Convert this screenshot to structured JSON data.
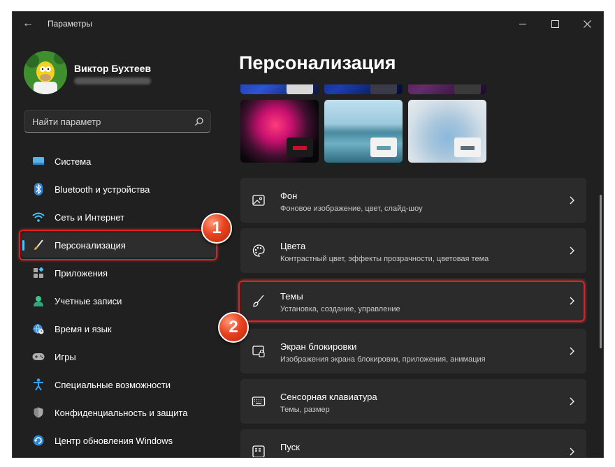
{
  "window": {
    "title": "Параметры",
    "back_icon": "back-arrow-icon",
    "controls": [
      "minimize-icon",
      "maximize-icon",
      "close-icon"
    ]
  },
  "user": {
    "name": "Виктор Бухтеев",
    "avatar_icon": "avatar-image-icon"
  },
  "search": {
    "placeholder": "Найти параметр",
    "icon": "search-icon"
  },
  "sidebar": {
    "items": [
      {
        "label": "Система",
        "icon": "system-icon"
      },
      {
        "label": "Bluetooth и устройства",
        "icon": "bluetooth-icon"
      },
      {
        "label": "Сеть и Интернет",
        "icon": "wifi-icon"
      },
      {
        "label": "Персонализация",
        "icon": "brush-icon",
        "selected": true
      },
      {
        "label": "Приложения",
        "icon": "apps-icon"
      },
      {
        "label": "Учетные записи",
        "icon": "person-icon"
      },
      {
        "label": "Время и язык",
        "icon": "globe-clock-icon"
      },
      {
        "label": "Игры",
        "icon": "gamepad-icon"
      },
      {
        "label": "Специальные возможности",
        "icon": "accessibility-icon"
      },
      {
        "label": "Конфиденциальность и защита",
        "icon": "shield-icon"
      },
      {
        "label": "Центр обновления Windows",
        "icon": "update-icon"
      }
    ]
  },
  "main": {
    "title": "Персонализация",
    "themes": [
      {
        "name": "glow",
        "accent": "#c8102e"
      },
      {
        "name": "captured-motion",
        "accent": "#5f9ea8"
      },
      {
        "name": "flow",
        "accent": "#5f6f7a"
      }
    ],
    "settings": [
      {
        "title": "Фон",
        "description": "Фоновое изображение, цвет, слайд-шоу",
        "icon": "picture-icon"
      },
      {
        "title": "Цвета",
        "description": "Контрастный цвет, эффекты прозрачности, цветовая тема",
        "icon": "palette-icon"
      },
      {
        "title": "Темы",
        "description": "Установка, создание, управление",
        "icon": "brush-icon"
      },
      {
        "title": "Экран блокировки",
        "description": "Изображения экрана блокировки, приложения, анимация",
        "icon": "lock-screen-icon"
      },
      {
        "title": "Сенсорная клавиатура",
        "description": "Темы, размер",
        "icon": "keyboard-icon"
      },
      {
        "title": "Пуск",
        "description": "",
        "icon": "start-menu-icon"
      }
    ]
  },
  "annotations": {
    "marker_1": "1",
    "marker_2": "2",
    "highlight_color": "#e02020"
  },
  "colors": {
    "background": "#202020",
    "card": "#2b2b2b",
    "accent": "#4cc2ff"
  }
}
